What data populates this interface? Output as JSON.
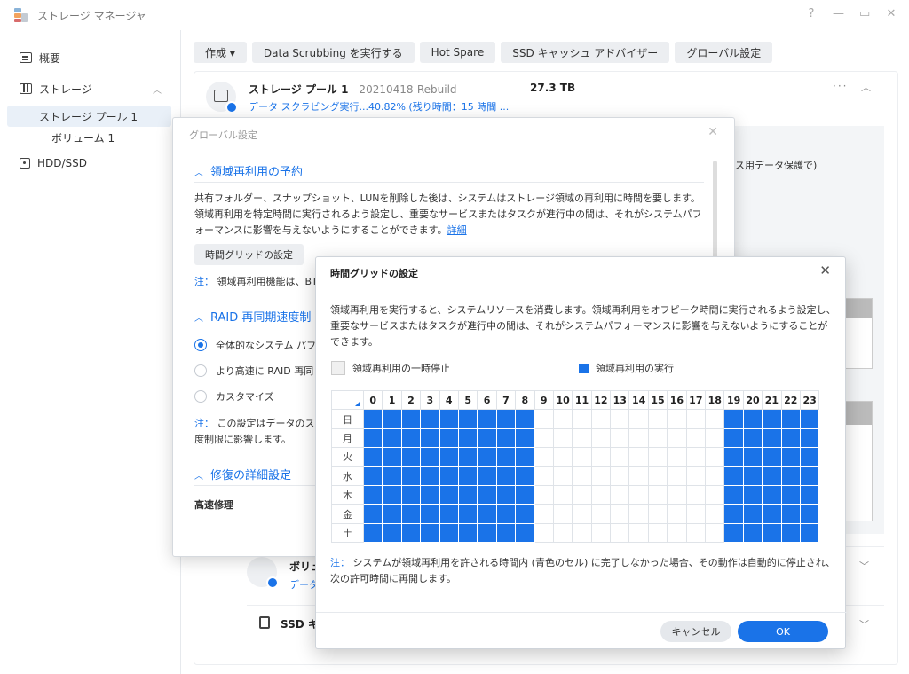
{
  "window": {
    "title": "ストレージ マネージャ",
    "controls": [
      "?",
      "—",
      "▭",
      "✕"
    ]
  },
  "sidebar": {
    "items": [
      {
        "label": "概要",
        "icon": "summary-icon"
      },
      {
        "label": "ストレージ",
        "icon": "storage-icon"
      },
      {
        "label": "ストレージ プール 1"
      },
      {
        "label": "ボリューム 1"
      },
      {
        "label": "HDD/SSD",
        "icon": "hdd-icon"
      }
    ]
  },
  "toolbar": {
    "create": "作成 ▾",
    "scrub": "Data Scrubbing を実行する",
    "hotspare": "Hot Spare",
    "ssd_advisor": "SSD キャッシュ アドバイザー",
    "global": "グローバル設定"
  },
  "pool": {
    "title": "ストレージ プール 1",
    "subtitle": " - 20210418-Rebuild",
    "size": "27.3 TB",
    "status": "データ スクラビング実行...40.82% (残り時間：15 時間 ..."
  },
  "background": {
    "grey_text": "ス用データ保護で)",
    "volume_label": "ボリュ",
    "volume_status": "データ",
    "ssd_label": "SSD キ"
  },
  "global_dialog": {
    "title": "グローバル設定",
    "sec1_title": "領域再利用の予約",
    "sec1_text": "共有フォルダー、スナップショット、LUNを削除した後は、システムはストレージ領域の再利用に時間を要します。領域再利用を特定時間に実行されるよう設定し、重要なサービスまたはタスクが進行中の間は、それがシステムパフォーマンスに影響を与えないようにすることができます。",
    "sec1_link": "詳細",
    "grid_btn": "時間グリッドの設定",
    "note_label": "注：",
    "sec1_note": "領域再利用機能は、BT",
    "sec2_title": "RAID 再同期速度制",
    "radio1": "全体的なシステム パフ",
    "radio2": "より高速に RAID 再同",
    "radio3": "カスタマイズ",
    "sec2_note1": "この設定はデータのス",
    "sec2_note2": "度制限に影響します。",
    "sec3_title": "修復の詳細設定",
    "fast_repair": "高速修理"
  },
  "time_dialog": {
    "title": "時間グリッドの設定",
    "desc": "領域再利用を実行すると、システムリソースを消費します。領域再利用をオフピーク時間に実行されるよう設定し、重要なサービスまたはタスクが進行中の間は、それがシステムパフォーマンスに影響を与えないようにすることができます。",
    "legend_pause": "領域再利用の一時停止",
    "legend_run": "領域再利用の実行",
    "hours": [
      "0",
      "1",
      "2",
      "3",
      "4",
      "5",
      "6",
      "7",
      "8",
      "9",
      "10",
      "11",
      "12",
      "13",
      "14",
      "15",
      "16",
      "17",
      "18",
      "19",
      "20",
      "21",
      "22",
      "23"
    ],
    "days": [
      "日",
      "月",
      "火",
      "水",
      "木",
      "金",
      "土"
    ],
    "active_hours": [
      0,
      1,
      2,
      3,
      4,
      5,
      6,
      7,
      8,
      19,
      20,
      21,
      22,
      23
    ],
    "note_label": "注：",
    "note": "システムが領域再利用を許される時間内 (青色のセル) に完了しなかった場合、その動作は自動的に停止され、次の許可時間に再開します。",
    "cancel": "キャンセル",
    "ok": "OK"
  },
  "colors": {
    "accent": "#1a73e8",
    "toolbar_bg": "#eceef1",
    "sidebar_selected": "#e9f0f8"
  }
}
